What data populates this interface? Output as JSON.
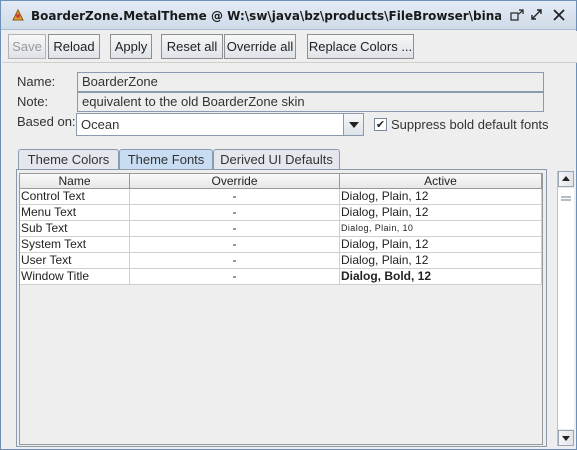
{
  "window": {
    "title": "BoarderZone.MetalTheme @ W:\\sw\\java\\bz\\products\\FileBrowser\\binary\\conf\\the...",
    "icon": "app-icon",
    "controls": [
      "restore-icon",
      "maximize-icon",
      "close-icon"
    ]
  },
  "toolbar": {
    "save_label": "Save",
    "reload_label": "Reload",
    "apply_label": "Apply",
    "reset_all_label": "Reset all",
    "override_all_label": "Override all",
    "replace_colors_label": "Replace Colors ..."
  },
  "form": {
    "name_label": "Name:",
    "name_value": "BoarderZone",
    "note_label": "Note:",
    "note_value": "equivalent to the old BoarderZone skin",
    "based_on_label": "Based on:",
    "based_on_value": "Ocean",
    "suppress_bold_label": "Suppress bold default fonts",
    "suppress_bold_checked": true
  },
  "tabs": [
    {
      "label": "Theme Colors",
      "active": false
    },
    {
      "label": "Theme Fonts",
      "active": true
    },
    {
      "label": "Derived UI Defaults",
      "active": false
    }
  ],
  "table": {
    "columns": [
      "Name",
      "Override",
      "Active"
    ],
    "rows": [
      {
        "name": "Control Text",
        "override": "-",
        "active": "Dialog, Plain, 12",
        "style": "normal"
      },
      {
        "name": "Menu Text",
        "override": "-",
        "active": "Dialog, Plain, 12",
        "style": "normal"
      },
      {
        "name": "Sub Text",
        "override": "-",
        "active": "Dialog, Plain, 10",
        "style": "small"
      },
      {
        "name": "System Text",
        "override": "-",
        "active": "Dialog, Plain, 12",
        "style": "normal"
      },
      {
        "name": "User Text",
        "override": "-",
        "active": "Dialog, Plain, 12",
        "style": "normal"
      },
      {
        "name": "Window Title",
        "override": "-",
        "active": "Dialog, Bold, 12",
        "style": "bold"
      }
    ]
  },
  "colors": {
    "accent": "#c8dcf2",
    "border": "#8a9bb0"
  }
}
